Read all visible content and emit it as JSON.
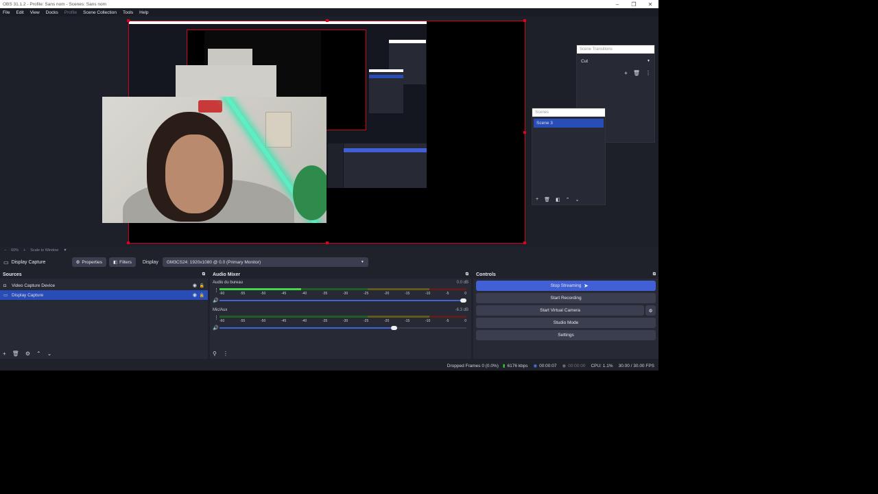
{
  "window": {
    "title": "OBS 31.1.2 - Profile: Sans nom - Scenes: Sans nom",
    "minimize": "–",
    "restore": "❐",
    "close": "✕"
  },
  "menu": [
    "File",
    "Edit",
    "View",
    "Docks",
    "Profile",
    "Scene Collection",
    "Tools",
    "Help"
  ],
  "preview": {
    "scene_transitions": {
      "title": "Scene Transitions",
      "selected": "Cut"
    },
    "scenes": {
      "title": "Scenes",
      "items": [
        "Scene 3"
      ]
    }
  },
  "preview_bar": {
    "zoom_minus": "–",
    "zoom": "60%",
    "zoom_plus": "+",
    "scale": "Scale to Window"
  },
  "context_bar": {
    "source": "Display Capture",
    "properties": "Properties",
    "filters": "Filters",
    "display_label": "Display",
    "display_value": "GM3CS24: 1920x1080 @ 0.0 (Primary Monitor)"
  },
  "sources": {
    "title": "Sources",
    "items": [
      {
        "name": "Video Capture Device",
        "selected": false
      },
      {
        "name": "Display Capture",
        "selected": true
      }
    ]
  },
  "mixer": {
    "title": "Audio Mixer",
    "ticks": [
      "-60",
      "-55",
      "-50",
      "-45",
      "-40",
      "-35",
      "-30",
      "-25",
      "-20",
      "-15",
      "-10",
      "-5",
      "0"
    ],
    "channels": [
      {
        "name": "Audio du bureau",
        "db": "0.0 dB",
        "level": 0.33,
        "volume": 1.0
      },
      {
        "name": "Mic/Aux",
        "db": "-6.3 dB",
        "level": 0.0,
        "volume": 0.72
      }
    ]
  },
  "controls": {
    "title": "Controls",
    "stop_streaming": "Stop Streaming",
    "start_recording": "Start Recording",
    "start_virtual_camera": "Start Virtual Camera",
    "studio_mode": "Studio Mode",
    "settings": "Settings"
  },
  "status": {
    "dropped_frames": "Dropped Frames 0 (0.0%)",
    "bitrate": "6176 kbps",
    "stream_time": "00:00:07",
    "rec_time": "00:00:00",
    "cpu": "CPU: 1.1%",
    "fps": "30.00 / 30.00 FPS"
  },
  "colors": {
    "accent": "#4160d6",
    "selection": "#284cb8",
    "canvas_border": "#d0001e"
  }
}
